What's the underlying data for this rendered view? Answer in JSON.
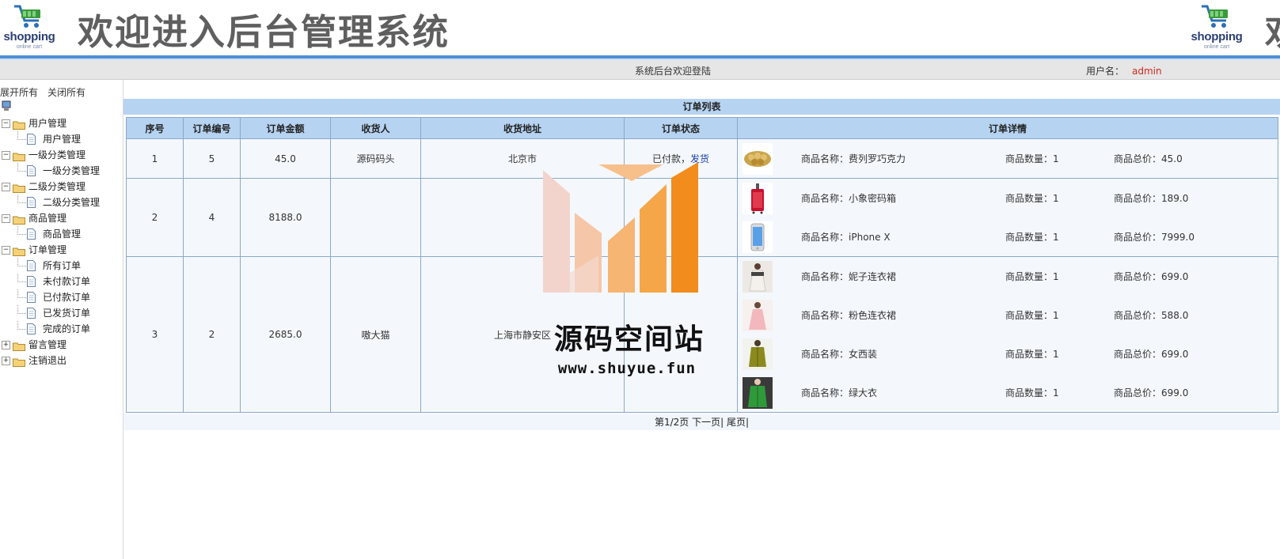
{
  "header": {
    "logo_text": "shopping",
    "logo_subtext": "online cart",
    "title": "欢迎进入后台管理系统"
  },
  "topbar": {
    "welcome": "系统后台欢迎登陆",
    "user_label": "用户名：",
    "username": "admin"
  },
  "sidebar": {
    "expand_all": "展开所有",
    "collapse_all": "关闭所有",
    "tree": [
      {
        "label": "用户管理",
        "children": [
          "用户管理"
        ]
      },
      {
        "label": "一级分类管理",
        "children": [
          "一级分类管理"
        ]
      },
      {
        "label": "二级分类管理",
        "children": [
          "二级分类管理"
        ]
      },
      {
        "label": "商品管理",
        "children": [
          "商品管理"
        ]
      },
      {
        "label": "订单管理",
        "children": [
          "所有订单",
          "未付款订单",
          "已付款订单",
          "已发货订单",
          "完成的订单"
        ]
      },
      {
        "label": "留言管理",
        "children": [],
        "collapsed": true
      },
      {
        "label": "注销退出",
        "children": [],
        "collapsed": true
      }
    ]
  },
  "main": {
    "list_title": "订单列表",
    "columns": [
      "序号",
      "订单编号",
      "订单金额",
      "收货人",
      "收货地址",
      "订单状态",
      "订单详情"
    ],
    "item_labels": {
      "name": "商品名称：",
      "qty": "商品数量：",
      "total": "商品总价："
    },
    "orders": [
      {
        "seq": "1",
        "order_no": "5",
        "amount": "45.0",
        "receiver": "源码码头",
        "address": "北京市",
        "status": "已付款，",
        "action": "发货",
        "items": [
          {
            "name": "费列罗巧克力",
            "qty": "1",
            "total": "45.0",
            "thumb": "chocolate"
          }
        ]
      },
      {
        "seq": "2",
        "order_no": "4",
        "amount": "8188.0",
        "receiver": "",
        "address": "",
        "status": "付",
        "action": "",
        "items": [
          {
            "name": "小象密码箱",
            "qty": "1",
            "total": "189.0",
            "thumb": "suitcase"
          },
          {
            "name": "iPhone X",
            "qty": "1",
            "total": "7999.0",
            "thumb": "phone"
          }
        ]
      },
      {
        "seq": "3",
        "order_no": "2",
        "amount": "2685.0",
        "receiver": "嗷大猫",
        "address": "上海市静安区",
        "status": "",
        "action": "",
        "items": [
          {
            "name": "妮子连衣裙",
            "qty": "1",
            "total": "699.0",
            "thumb": "dress-white"
          },
          {
            "name": "粉色连衣裙",
            "qty": "1",
            "total": "588.0",
            "thumb": "dress-pink"
          },
          {
            "name": "女西装",
            "qty": "1",
            "total": "699.0",
            "thumb": "suit-olive"
          },
          {
            "name": "绿大衣",
            "qty": "1",
            "total": "699.0",
            "thumb": "coat-green"
          }
        ]
      }
    ],
    "pager": {
      "info": "第1/2页",
      "next": "下一页",
      "last": "尾页"
    }
  },
  "watermark": {
    "title": "源码空间站",
    "url": "www.shuyue.fun"
  },
  "colors": {
    "accent": "#4f8fd6",
    "header_bg": "#b6d3f1",
    "username": "#d0281e",
    "link": "#1e3fa8",
    "watermark_orange": "#f39a2e"
  }
}
